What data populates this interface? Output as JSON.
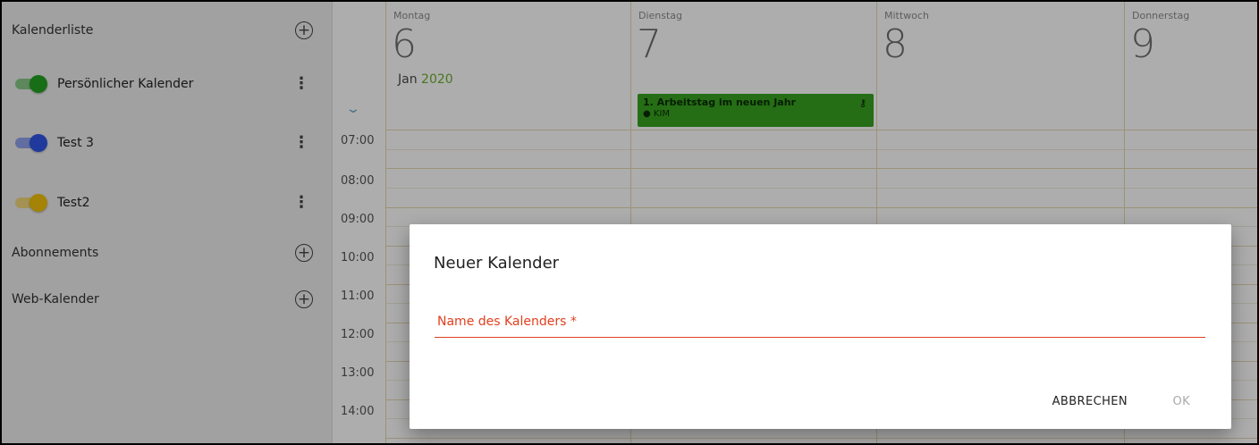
{
  "sidebar": {
    "calendar_list_title": "Kalenderliste",
    "calendars": [
      {
        "name": "Persönlicher Kalender",
        "color": "#22a321"
      },
      {
        "name": "Test 3",
        "color": "#2f56e6"
      },
      {
        "name": "Test2",
        "color": "#f2c20a"
      }
    ],
    "subscriptions_title": "Abonnements",
    "web_calendar_title": "Web-Kalender",
    "add_symbol": "+",
    "more_symbol": "⋮"
  },
  "calendar": {
    "month_label": "Jan",
    "year_label": "2020",
    "days": [
      {
        "name": "Montag",
        "number": "6"
      },
      {
        "name": "Dienstag",
        "number": "7"
      },
      {
        "name": "Mittwoch",
        "number": "8"
      },
      {
        "name": "Donnerstag",
        "number": "9"
      }
    ],
    "times": [
      "07:00",
      "08:00",
      "09:00",
      "10:00",
      "11:00",
      "12:00",
      "13:00",
      "14:00"
    ],
    "event": {
      "title": "1. Arbeitstag im neuen Jahr",
      "location": "KIM",
      "color": "#37a31f"
    },
    "expand_icon": "chevron-down-icon"
  },
  "dialog": {
    "title": "Neuer Kalender",
    "field_label": "Name des Kalenders *",
    "cancel_label": "ABBRECHEN",
    "ok_label": "OK"
  },
  "colors": {
    "accent_error": "#e0401e",
    "grid_line": "#e6d7b0"
  }
}
